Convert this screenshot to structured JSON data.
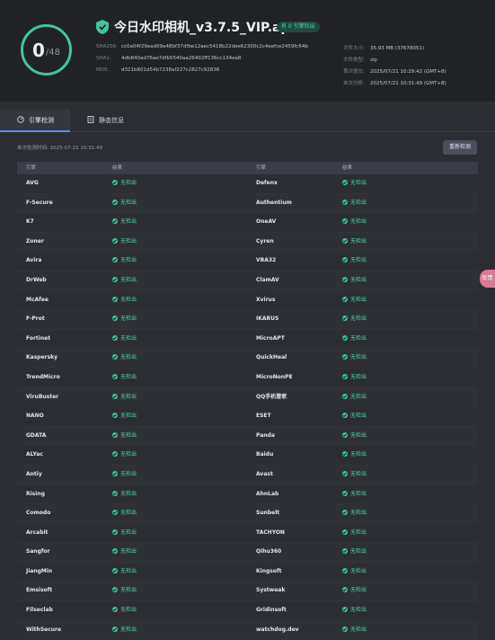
{
  "file": {
    "score": "0",
    "total": "/48",
    "name": "今日水印相机_v3.7.5_VIP.apk",
    "badge": "有 0 引擎检出"
  },
  "hashes": [
    {
      "key": "SHA256:",
      "value": "cc0a04f29ead09a48bf37dfbe12aec5418b22dee62300c2c4eefce2459fc64b"
    },
    {
      "key": "SHA1:",
      "value": "4db840ad76ae7dfb5540aa26402ff136cc134ea8"
    },
    {
      "key": "MD5:",
      "value": "d321b801d54b7238af227c2827c92836"
    }
  ],
  "info": [
    {
      "key": "文件大小:",
      "value": "35.93 MB (37678051)"
    },
    {
      "key": "文件类型:",
      "value": "zip"
    },
    {
      "key": "首次提交:",
      "value": "2025/07/21 10:29:42 (GMT+8)"
    },
    {
      "key": "末次分析:",
      "value": "2025/07/21 10:31:49 (GMT+8)"
    }
  ],
  "tabs": [
    {
      "label": "引擎检测",
      "icon": "gauge-icon",
      "active": true
    },
    {
      "label": "静态信息",
      "icon": "document-icon",
      "active": false
    }
  ],
  "last_scan": "末次检测时间: 2025-07-21 10:31:49",
  "rescan_label": "重新检测",
  "table": {
    "headers": [
      "引擎",
      "结果",
      "引擎",
      "结果"
    ],
    "rows": [
      [
        "AVG",
        "无检出",
        "Defenx",
        "无检出"
      ],
      [
        "F-Secure",
        "无检出",
        "Authentium",
        "无检出"
      ],
      [
        "K7",
        "无检出",
        "OneAV",
        "无检出"
      ],
      [
        "Zoner",
        "无检出",
        "Cyren",
        "无检出"
      ],
      [
        "Avira",
        "无检出",
        "VBA32",
        "无检出"
      ],
      [
        "DrWeb",
        "无检出",
        "ClamAV",
        "无检出"
      ],
      [
        "McAfee",
        "无检出",
        "Xvirus",
        "无检出"
      ],
      [
        "F-Prot",
        "无检出",
        "IKARUS",
        "无检出"
      ],
      [
        "Fortinet",
        "无检出",
        "MicroAPT",
        "无检出"
      ],
      [
        "Kaspersky",
        "无检出",
        "QuickHeal",
        "无检出"
      ],
      [
        "TrendMicro",
        "无检出",
        "MicroNonPE",
        "无检出"
      ],
      [
        "ViruBuster",
        "无检出",
        "QQ手机管家",
        "无检出"
      ],
      [
        "NANO",
        "无检出",
        "ESET",
        "无检出"
      ],
      [
        "GDATA",
        "无检出",
        "Panda",
        "无检出"
      ],
      [
        "ALYac",
        "无检出",
        "Baidu",
        "无检出"
      ],
      [
        "Antiy",
        "无检出",
        "Avast",
        "无检出"
      ],
      [
        "Rising",
        "无检出",
        "AhnLab",
        "无检出"
      ],
      [
        "Comodo",
        "无检出",
        "Sunbelt",
        "无检出"
      ],
      [
        "Arcabit",
        "无检出",
        "TACHYON",
        "无检出"
      ],
      [
        "Sangfor",
        "无检出",
        "Qihu360",
        "无检出"
      ],
      [
        "JiangMin",
        "无检出",
        "Kingsoft",
        "无检出"
      ],
      [
        "Emsisoft",
        "无检出",
        "Systweak",
        "无检出"
      ],
      [
        "Filseclab",
        "无检出",
        "Gridinsoft",
        "无检出"
      ],
      [
        "WithSecure",
        "无检出",
        "watchdog.dev",
        "无检出"
      ]
    ]
  },
  "float_label": "反馈",
  "colors": {
    "accent": "#3ec799",
    "tab_active": "#5b8def",
    "float": "#d97a96"
  }
}
